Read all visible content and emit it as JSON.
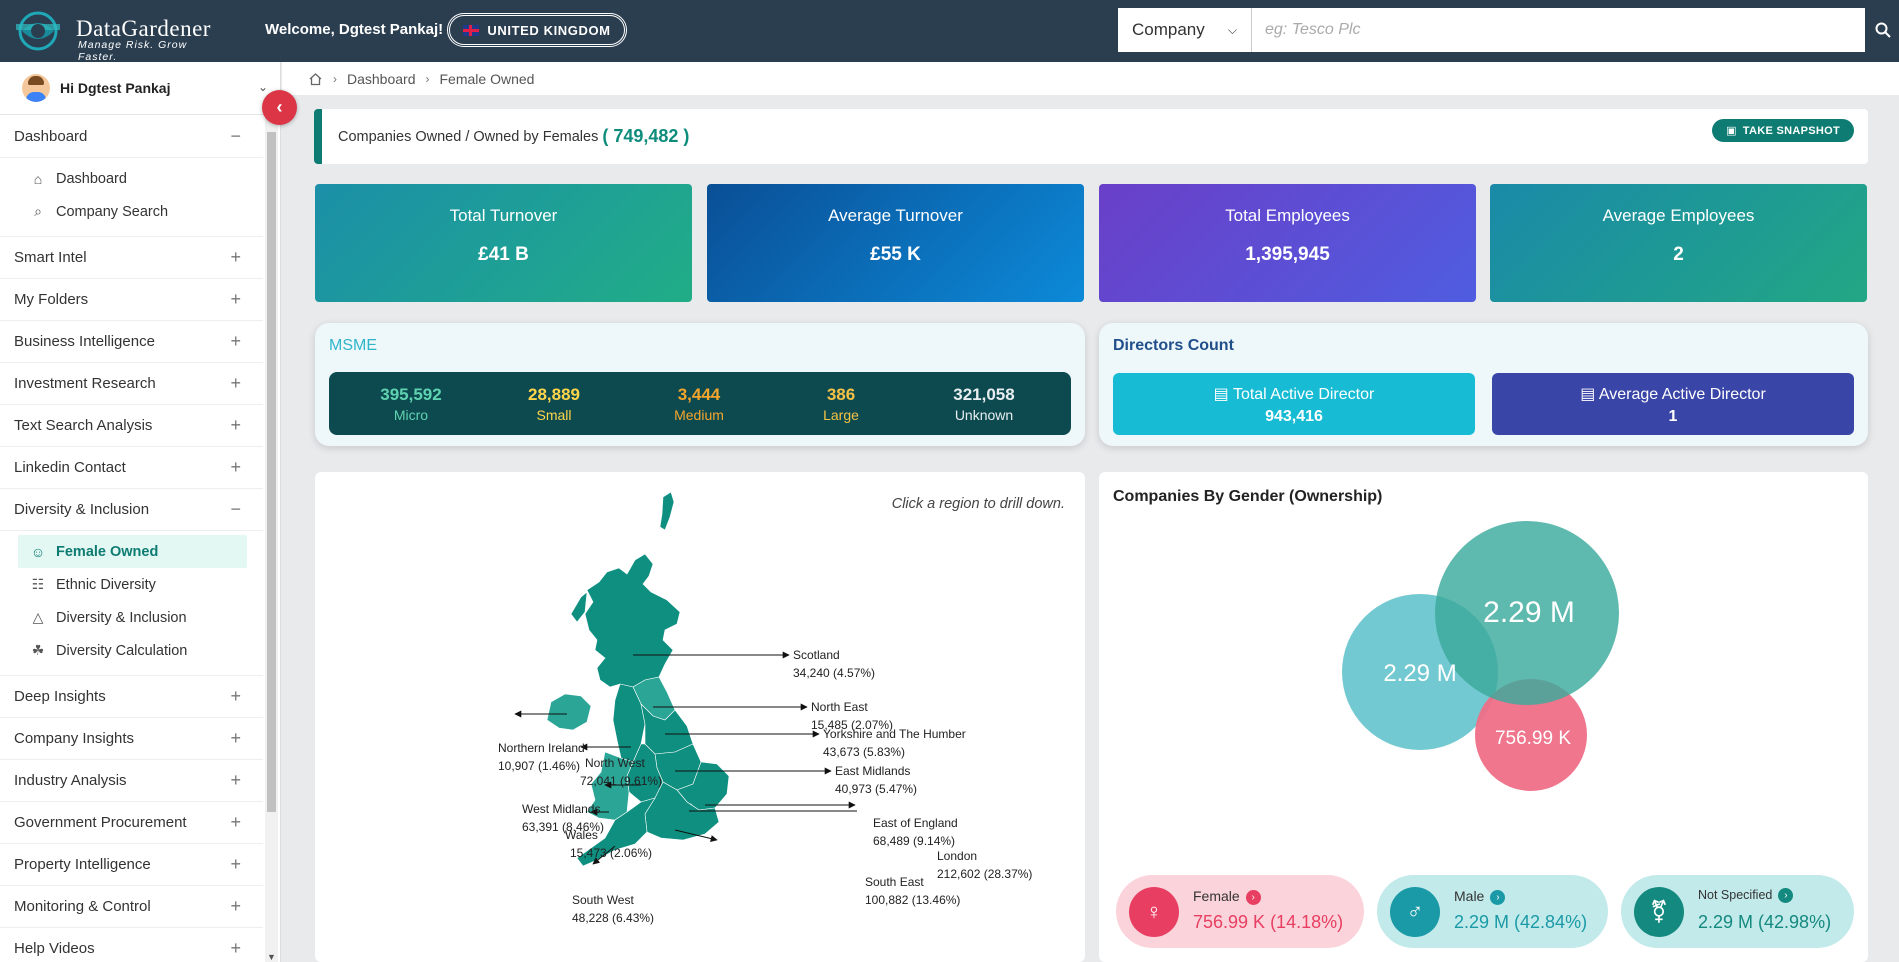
{
  "header": {
    "logo_title": "DataGardener",
    "logo_tagline": "Manage Risk. Grow Faster.",
    "welcome": "Welcome, Dgtest Pankaj!",
    "country": "UNITED KINGDOM",
    "search_type": "Company",
    "search_placeholder": "eg: Tesco Plc"
  },
  "sidebar": {
    "user": "Hi Dgtest Pankaj",
    "dashboard_group": "Dashboard",
    "dashboard_items": [
      "Dashboard",
      "Company Search"
    ],
    "groups_a": [
      "Smart Intel",
      "My Folders",
      "Business Intelligence",
      "Investment Research",
      "Text Search Analysis",
      "Linkedin Contact"
    ],
    "diversity_group": "Diversity & Inclusion",
    "diversity_items": [
      "Female Owned",
      "Ethnic Diversity",
      "Diversity & Inclusion",
      "Diversity Calculation"
    ],
    "groups_b": [
      "Deep Insights",
      "Company Insights",
      "Industry Analysis",
      "Government Procurement",
      "Property Intelligence",
      "Monitoring & Control",
      "Help Videos"
    ]
  },
  "breadcrumb": [
    "Dashboard",
    "Female Owned"
  ],
  "page": {
    "title": "Companies Owned / Owned by Females",
    "count": "( 749,482 )",
    "snapshot_label": "TAKE SNAPSHOT"
  },
  "stats": [
    {
      "label": "Total Turnover",
      "value": "£41 B"
    },
    {
      "label": "Average Turnover",
      "value": "£55 K"
    },
    {
      "label": "Total Employees",
      "value": "1,395,945"
    },
    {
      "label": "Average Employees",
      "value": "2"
    }
  ],
  "msme": {
    "title": "MSME",
    "items": [
      {
        "value": "395,592",
        "label": "Micro",
        "color": "#5fd3b0"
      },
      {
        "value": "28,889",
        "label": "Small",
        "color": "#ffd54a"
      },
      {
        "value": "3,444",
        "label": "Medium",
        "color": "#f4a52c"
      },
      {
        "value": "386",
        "label": "Large",
        "color": "#f6c244"
      },
      {
        "value": "321,058",
        "label": "Unknown",
        "color": "#e8eef0"
      }
    ]
  },
  "directors": {
    "title": "Directors Count",
    "total_label": "Total Active Director",
    "total_value": "943,416",
    "avg_label": "Average Active Director",
    "avg_value": "1"
  },
  "map": {
    "hint": "Click a region to drill down.",
    "regions": [
      {
        "name": "Scotland",
        "value": "34,240 (4.57%)"
      },
      {
        "name": "North East",
        "value": "15,485 (2.07%)"
      },
      {
        "name": "Northern Ireland",
        "value": "10,907 (1.46%)"
      },
      {
        "name": "Yorkshire and The Humber",
        "value": "43,673 (5.83%)"
      },
      {
        "name": "North West",
        "value": "72,041 (9.61%)"
      },
      {
        "name": "East Midlands",
        "value": "40,973 (5.47%)"
      },
      {
        "name": "West Midlands",
        "value": "63,391 (8.46%)"
      },
      {
        "name": "East of England",
        "value": "68,489 (9.14%)"
      },
      {
        "name": "Wales",
        "value": "15,473 (2.06%)"
      },
      {
        "name": "London",
        "value": "212,602 (28.37%)"
      },
      {
        "name": "South East",
        "value": "100,882 (13.46%)"
      },
      {
        "name": "South West",
        "value": "48,228 (6.43%)"
      }
    ]
  },
  "gender": {
    "title": "Companies By Gender (Ownership)",
    "bubbles": [
      "2.29 M",
      "2.29 M",
      "756.99 K"
    ],
    "pills": [
      {
        "label": "Female",
        "value": "756.99 K (14.18%)",
        "color": "#e83e62"
      },
      {
        "label": "Male",
        "value": "2.29 M (42.84%)",
        "color": "#1a9aa6"
      },
      {
        "label": "Not Specified",
        "value": "2.29 M (42.98%)",
        "color": "#14897f"
      }
    ]
  }
}
